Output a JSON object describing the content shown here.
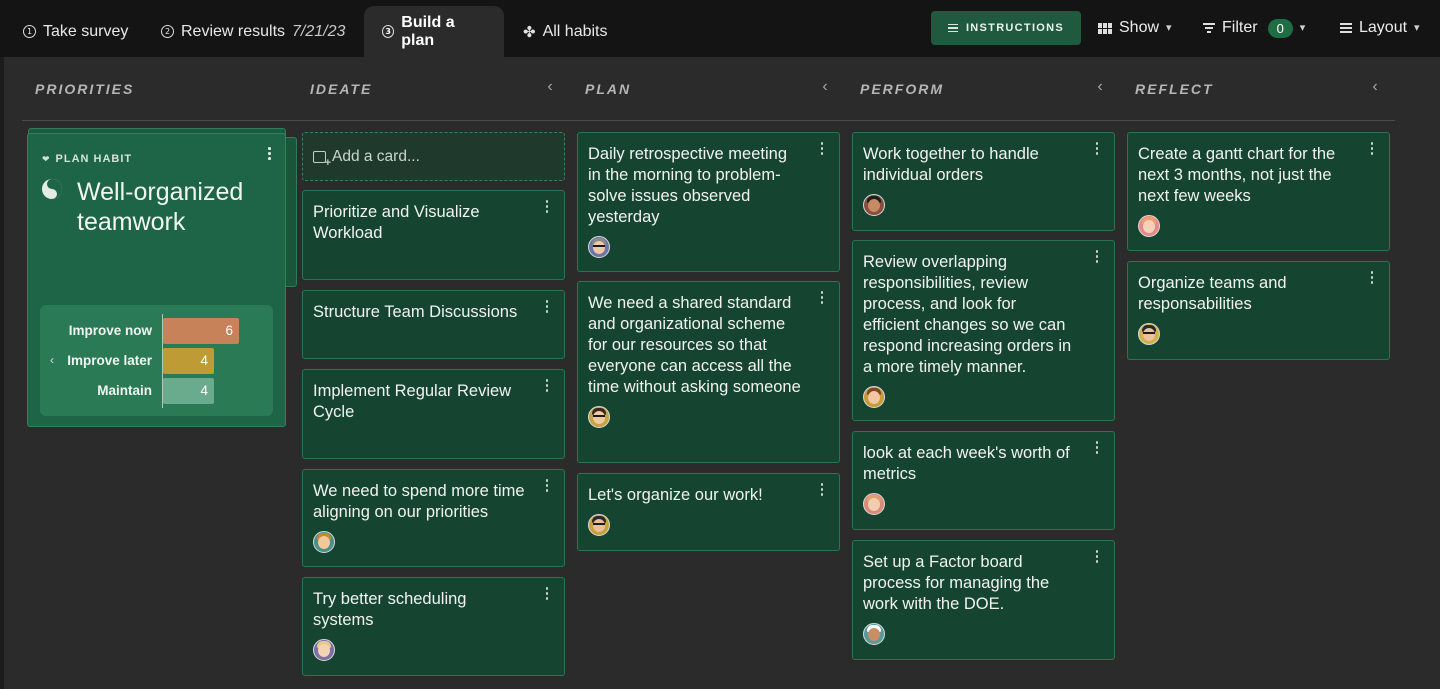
{
  "tabs": [
    {
      "num": "1",
      "label": "Take survey"
    },
    {
      "num": "2",
      "label": "Review results",
      "date": "7/21/23"
    },
    {
      "num": "3",
      "label": "Build a plan"
    },
    {
      "label": "All habits"
    }
  ],
  "toolbar": {
    "instructions": "INSTRUCTIONS",
    "show": "Show",
    "filter": "Filter",
    "filter_count": "0",
    "layout": "Layout"
  },
  "columns": {
    "priorities": "PRIORITIES",
    "ideate": "IDEATE",
    "plan": "PLAN",
    "perform": "PERFORM",
    "reflect": "REFLECT"
  },
  "habit": {
    "label": "PLAN HABIT",
    "title": "Well-organized teamwork",
    "stats": [
      {
        "label": "Improve now",
        "value": "6",
        "color": "#c8825a"
      },
      {
        "label": "Improve later",
        "value": "4",
        "color": "#bf9b35"
      },
      {
        "label": "Maintain",
        "value": "4",
        "color": "#6aab8e"
      }
    ]
  },
  "add_card": "Add a card...",
  "ideate_cards": [
    "Prioritize and Visualize Workload",
    "Structure Team Discussions",
    "Implement Regular Review Cycle",
    "We need to spend more time aligning on our priorities",
    "Try better scheduling systems"
  ],
  "plan_cards": [
    "Daily retrospective meeting in the morning to problem-solve issues observed yesterday",
    "We need a shared standard and organizational scheme for our resources so that everyone can access all the time without asking someone",
    "Let's organize our work!"
  ],
  "perform_cards": [
    "Work together to handle individual orders",
    "Review overlapping responsibilities, review process, and look for efficient changes so we can respond increasing orders in a more timely manner.",
    "look at each week's worth of metrics",
    "Set up a Factor board process for managing the work with the DOE."
  ],
  "reflect_cards": [
    "Create a gantt chart for the next 3 months, not just the next few weeks",
    "Organize teams and responsabilities"
  ],
  "colors": {
    "card_bg": "#154530",
    "accent": "#1d6e45",
    "board_bg": "#2b2b2b"
  }
}
